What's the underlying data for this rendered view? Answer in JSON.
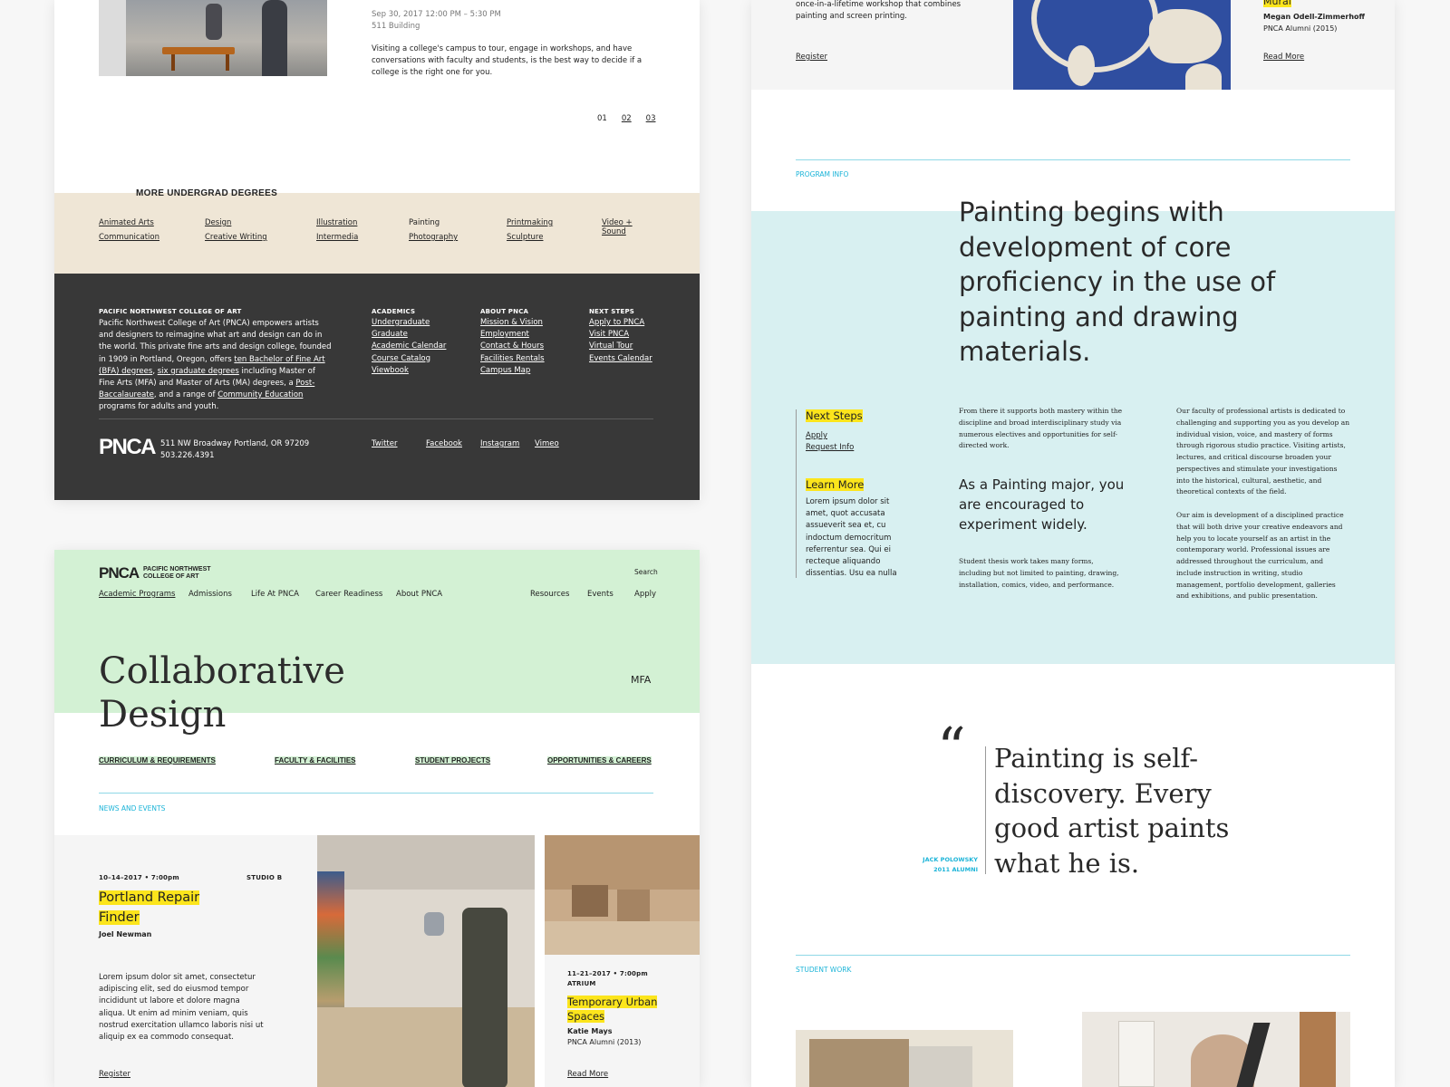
{
  "top_left": {
    "event": {
      "date": "Sep 30, 2017 12:00 PM – 5:30 PM",
      "location": "511 Building",
      "description": "Visiting a college's campus to tour, engage in workshops, and have conversations with faculty and students, is the best way to decide if a college is the right one for you."
    },
    "pagination": [
      "01",
      "02",
      "03"
    ],
    "degrees": {
      "title": "MORE UNDERGRAD DEGREES",
      "links": [
        "Animated Arts",
        "Communication",
        "Design",
        "Creative Writing",
        "Illustration",
        "Intermedia",
        "Painting",
        "Photography",
        "Printmaking",
        "Sculpture",
        "Video + Sound"
      ]
    },
    "footer": {
      "about_title": "PACIFIC NORTHWEST COLLEGE OF ART",
      "about_parts": [
        "Pacific Northwest College of Art (PNCA) empowers artists and designers to reimagine what art and design can do in the world. This private fine arts and design college, founded in 1909 in Portland, Oregon, offers ",
        "ten Bachelor of Fine Art (BFA) degrees",
        ", ",
        "six graduate degrees",
        " including Master of Fine Arts (MFA) and Master of Arts (MA) degrees, a ",
        "Post-Baccalaureate",
        ", and a range of ",
        "Community Education",
        " programs for adults and youth."
      ],
      "columns": [
        {
          "title": "ACADEMICS",
          "links": [
            "Undergraduate",
            "Graduate",
            "Academic Calendar",
            "Course Catalog",
            "Viewbook"
          ]
        },
        {
          "title": "ABOUT PNCA",
          "links": [
            "Mission & Vision",
            "Employment",
            "Contact & Hours",
            "Facilities Rentals",
            "Campus Map"
          ]
        },
        {
          "title": "NEXT STEPS",
          "links": [
            "Apply to PNCA",
            "Visit PNCA",
            "Virtual Tour",
            "Events Calendar"
          ]
        }
      ],
      "logo": "PNCA",
      "address": "511 NW Broadway Portland, OR 97209",
      "phone": "503.226.4391",
      "social": [
        "Twitter",
        "Facebook",
        "Instagram",
        "Vimeo"
      ]
    }
  },
  "bottom_left": {
    "logo": "PNCA",
    "logo_sub1": "PACIFIC NORTHWEST",
    "logo_sub2": "COLLEGE OF ART",
    "search": "Search",
    "nav": [
      "Academic Programs",
      "Admissions",
      "Life At PNCA",
      "Career Readiness",
      "About PNCA"
    ],
    "nav_right": [
      "Resources",
      "Events",
      "Apply"
    ],
    "title_line1": "Collaborative",
    "title_line2": "Design",
    "degree": "MFA",
    "tabs": [
      "CURRICULUM & REQUIREMENTS",
      "FACULTY & FACILITIES",
      "STUDENT PROJECTS",
      "OPPORTUNITIES & CAREERS"
    ],
    "news_label": "NEWS AND EVENTS",
    "event1": {
      "date": "10–14–2017 • 7:00pm",
      "venue": "STUDIO B",
      "title_line1": "Portland Repair",
      "title_line2": "Finder",
      "person": "Joel Newman",
      "desc": "Lorem ipsum dolor sit amet, consectetur adipiscing elit, sed do eiusmod tempor incididunt ut labore et dolore magna aliqua. Ut enim ad minim veniam, quis nostrud exercitation ullamco laboris nisi ut aliquip ex ea commodo consequat.",
      "link": "Register"
    },
    "event2": {
      "date": "11–21–2017 • 7:00pm",
      "venue": "ATRIUM",
      "title_line1": "Temporary Urban",
      "title_line2": "Spaces",
      "person": "Katie Mays",
      "role": "PNCA Alumni (2013)",
      "link": "Read More"
    }
  },
  "right": {
    "top": {
      "text": "once-in-a-lifetime workshop that combines painting and screen printing.",
      "register": "Register",
      "event_title": "Mural",
      "person": "Megan Odell-Zimmerhoff",
      "role": "PNCA Alumni (2015)",
      "read_more": "Read More"
    },
    "program_label": "PROGRAM INFO",
    "headline": "Painting begins with development of core proficiency in the use of painting and drawing materials.",
    "next_steps": {
      "title": "Next Steps",
      "links": [
        "Apply",
        "Request Info"
      ]
    },
    "learn_more": {
      "title": "Learn More",
      "text": "Lorem ipsum dolor sit amet, quot accusata assueverit sea et, cu indoctum democritum referrentur sea. Qui ei recteque aliquando dissentias. Usu ea nulla"
    },
    "col1_p1": "From there it supports both mastery within the discipline and broad interdisciplinary study via numerous electives and opportunities for self-directed work.",
    "col1_lead": "As a Painting major, you are encouraged to experiment widely.",
    "col1_p2": "Student thesis work takes many forms, including but not limited to painting, drawing, installation, comics, video, and performance.",
    "col2_p1": "Our faculty of professional artists is dedicated to challenging and supporting you as you develop an individual vision, voice, and mastery of forms through rigorous studio practice. Visiting artists, lectures, and critical discourse broaden your perspectives and stimulate your investigations into the historical, cultural, aesthetic, and theoretical contexts of the field.",
    "col2_p2": "Our aim is development of a disciplined practice that will both drive your creative endeavors and help you to locate yourself as an artist in the contemporary world. Professional issues are addressed throughout the curriculum, and include instruction in writing, studio management, portfolio development, galleries and exhibitions, and public presentation.",
    "quote": {
      "mark": "“",
      "text": "Painting is self-discovery. Every good artist paints what he is.",
      "author": "JACK POLOWSKY",
      "author_sub": "2011 ALUMNI"
    },
    "student_work": "STUDENT WORK"
  },
  "colors": {
    "beige": "#efe6d6",
    "dark": "#383838",
    "mint": "#d3f1d4",
    "cyan": "#d8f0f1",
    "highlight": "#fce51c",
    "accent": "#1cb4d8"
  }
}
